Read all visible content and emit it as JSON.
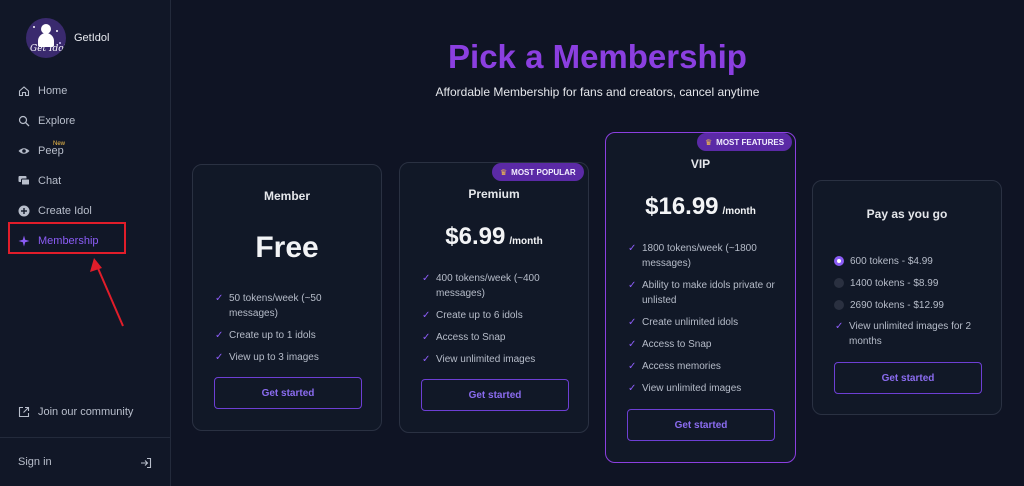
{
  "brand": {
    "name": "GetIdol",
    "logo_text": "Get Idol"
  },
  "nav": {
    "items": [
      {
        "label": "Home",
        "icon": "home-icon"
      },
      {
        "label": "Explore",
        "icon": "search-icon"
      },
      {
        "label": "Peep",
        "icon": "eye-icon",
        "badge": "New"
      },
      {
        "label": "Chat",
        "icon": "chat-icon"
      },
      {
        "label": "Create Idol",
        "icon": "plus-circle-icon"
      },
      {
        "label": "Membership",
        "icon": "sparkle-icon",
        "active": true
      }
    ],
    "community": "Join our community",
    "signin": "Sign in"
  },
  "header": {
    "title": "Pick a Membership",
    "subtitle": "Affordable Membership for fans and creators, cancel anytime"
  },
  "plans": {
    "member": {
      "name": "Member",
      "price": "Free",
      "features": [
        "50 tokens/week (~50 messages)",
        "Create up to 1 idols",
        "View up to 3 images"
      ],
      "cta": "Get started"
    },
    "premium": {
      "badge": "MOST POPULAR",
      "name": "Premium",
      "price": "$6.99",
      "period": "/month",
      "features": [
        "400 tokens/week (~400 messages)",
        "Create up to 6 idols",
        "Access to Snap",
        "View unlimited images"
      ],
      "cta": "Get started"
    },
    "vip": {
      "badge": "MOST FEATURES",
      "name": "VIP",
      "price": "$16.99",
      "period": "/month",
      "features": [
        "1800 tokens/week (~1800 messages)",
        "Ability to make idols private or unlisted",
        "Create unlimited idols",
        "Access to Snap",
        "Access memories",
        "View unlimited images"
      ],
      "cta": "Get started"
    },
    "payg": {
      "name": "Pay as you go",
      "options": [
        {
          "label": "600 tokens - $4.99",
          "selected": true
        },
        {
          "label": "1400 tokens - $8.99",
          "selected": false
        },
        {
          "label": "2690 tokens - $12.99",
          "selected": false
        }
      ],
      "feature": "View unlimited images for 2 months",
      "cta": "Get started"
    }
  },
  "colors": {
    "accent": "#8b5cf6",
    "title": "#8b3fe0",
    "annotation": "#e11d2a"
  }
}
